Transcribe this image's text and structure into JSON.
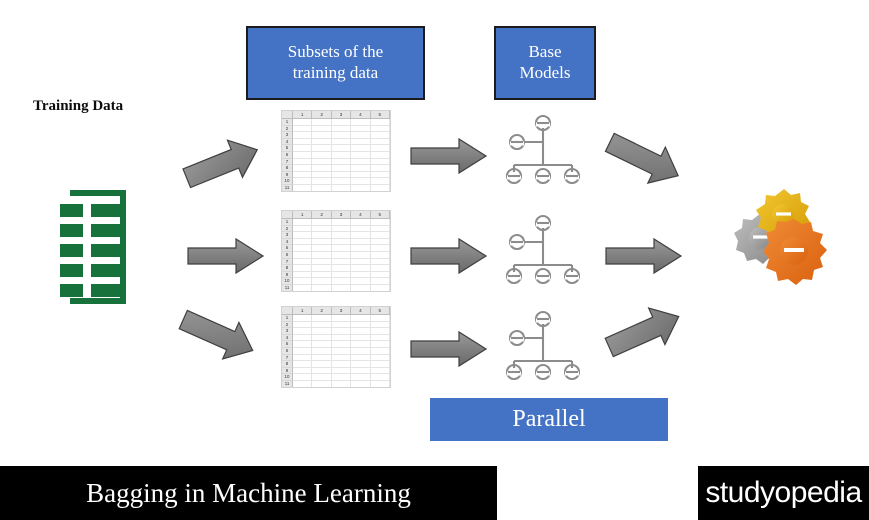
{
  "slide": {
    "title": "Bagging in Machine Learning",
    "brand": "studyopedia",
    "background_color": "#ffffff"
  },
  "colors": {
    "accent_blue": "#4472C4",
    "box_border": "#1b1b1b",
    "arrow_gray": "#7F7F7F",
    "arrow_gray_dark": "#595959",
    "excel_green": "#16713A",
    "banner_black": "#000000",
    "gear_gold": "#E8B41A",
    "gear_gray": "#9C9C9C",
    "gear_orange": "#E4701E",
    "tree_gray": "#808080"
  },
  "labels": {
    "training_data": "Training Data",
    "subsets": "Subsets of the\ntraining data",
    "subsets_line1": "Subsets of the",
    "subsets_line2": "training data",
    "base_models_line1": "Base",
    "base_models_line2": "Models",
    "parallel": "Parallel"
  },
  "icons": {
    "excel": "excel-spreadsheet-icon",
    "tree": "org-chart-tree-icon",
    "gears": "three-gears-icon",
    "arrow_right": "block-arrow-right-icon",
    "arrow_up_right": "block-arrow-up-right-icon",
    "arrow_down_right": "block-arrow-down-right-icon"
  },
  "sheet": {
    "columns": [
      "1",
      "2",
      "3",
      "4",
      "5"
    ],
    "rows": [
      "1",
      "2",
      "3",
      "4",
      "5",
      "6",
      "7",
      "8",
      "9",
      "10",
      "11"
    ],
    "corner": ""
  },
  "flow": {
    "branches": [
      {
        "id": "branch-1",
        "subset_label": "subset-table-1",
        "model_label": "base-model-tree-1"
      },
      {
        "id": "branch-2",
        "subset_label": "subset-table-2",
        "model_label": "base-model-tree-2"
      },
      {
        "id": "branch-3",
        "subset_label": "subset-table-3",
        "model_label": "base-model-tree-3"
      }
    ],
    "arrows": [
      {
        "name": "arrow-data-to-subset-1",
        "direction": "up-right"
      },
      {
        "name": "arrow-data-to-subset-2",
        "direction": "right"
      },
      {
        "name": "arrow-data-to-subset-3",
        "direction": "down-right"
      },
      {
        "name": "arrow-subset-to-model-1",
        "direction": "right"
      },
      {
        "name": "arrow-subset-to-model-2",
        "direction": "right"
      },
      {
        "name": "arrow-subset-to-model-3",
        "direction": "right"
      },
      {
        "name": "arrow-model-to-aggregate-1",
        "direction": "down-right"
      },
      {
        "name": "arrow-model-to-aggregate-2",
        "direction": "right"
      },
      {
        "name": "arrow-model-to-aggregate-3",
        "direction": "up-right"
      }
    ]
  }
}
